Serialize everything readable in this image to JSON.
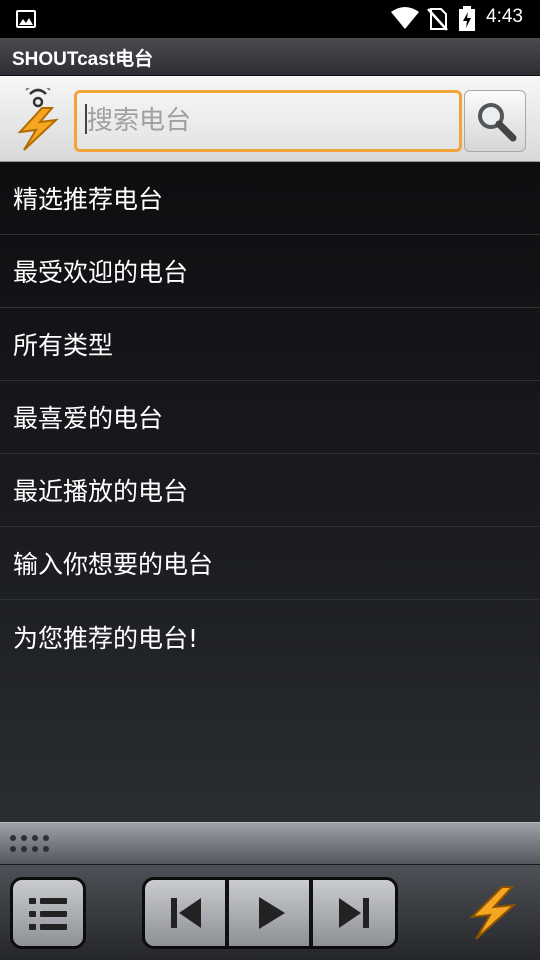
{
  "status_bar": {
    "time": "4:43",
    "icons": [
      "image-notification-icon",
      "wifi-icon",
      "no-sim-icon",
      "battery-charging-icon"
    ]
  },
  "app": {
    "title": "SHOUTcast电台"
  },
  "search": {
    "placeholder": "搜索电台",
    "value": "",
    "accent_color": "#f2a33a"
  },
  "menu": {
    "items": [
      {
        "label": "精选推荐电台"
      },
      {
        "label": "最受欢迎的电台"
      },
      {
        "label": "所有类型"
      },
      {
        "label": "最喜爱的电台"
      },
      {
        "label": "最近播放的电台"
      },
      {
        "label": "输入你想要的电台"
      },
      {
        "label": "为您推荐的电台!"
      }
    ]
  },
  "player": {
    "controls": [
      "list-icon",
      "previous-icon",
      "play-icon",
      "next-icon"
    ],
    "brand_color": "#f5a623"
  }
}
